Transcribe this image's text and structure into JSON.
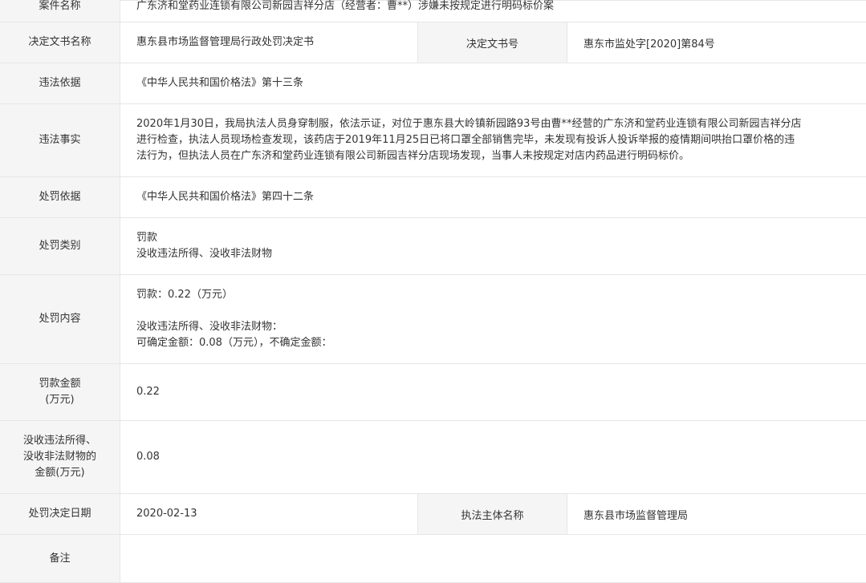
{
  "case_name": {
    "label": "案件名称",
    "value": "广东济和堂药业连锁有限公司新园吉祥分店（经营者：曹**）涉嫌未按规定进行明码标价案"
  },
  "decision_doc": {
    "label": "决定文书名称",
    "value": "惠东县市场监督管理局行政处罚决定书",
    "no_label": "决定文书号",
    "no_value": "惠东市监处字[2020]第84号"
  },
  "violation_basis": {
    "label": "违法依据",
    "value": "《中华人民共和国价格法》第十三条"
  },
  "violation_facts": {
    "label": "违法事实",
    "lines": [
      "2020年1月30日，我局执法人员身穿制服，依法示证，对位于惠东县大岭镇新园路93号由曹**经营的广东济和堂药业连锁有限公司新园吉祥分店",
      "进行检查，执法人员现场检查发现，该药店于2019年11月25日已将口罩全部销售完毕，未发现有投诉人投诉举报的疫情期间哄抬口罩价格的违",
      "法行为，但执法人员在广东济和堂药业连锁有限公司新园吉祥分店现场发现，当事人未按规定对店内药品进行明码标价。"
    ]
  },
  "penalty_basis": {
    "label": "处罚依据",
    "value": "《中华人民共和国价格法》第四十二条"
  },
  "penalty_type": {
    "label": "处罚类别",
    "lines": [
      "罚款",
      "没收违法所得、没收非法财物"
    ]
  },
  "penalty_content": {
    "label": "处罚内容",
    "line1": "罚款：0.22（万元）",
    "line2": "没收违法所得、没收非法财物：",
    "line3": "可确定金额：0.08（万元），不确定金额："
  },
  "fine_amount": {
    "label_line1": "罚款金额",
    "label_line2": "(万元)",
    "value": "0.22"
  },
  "confiscation_amount": {
    "label_line1": "没收违法所得、",
    "label_line2": "没收非法财物的",
    "label_line3": "金额(万元)",
    "value": "0.08"
  },
  "decision_date": {
    "label": "处罚决定日期",
    "value": "2020-02-13",
    "authority_label": "执法主体名称",
    "authority_value": "惠东县市场监督管理局"
  },
  "remarks": {
    "label": "备注",
    "value": ""
  }
}
